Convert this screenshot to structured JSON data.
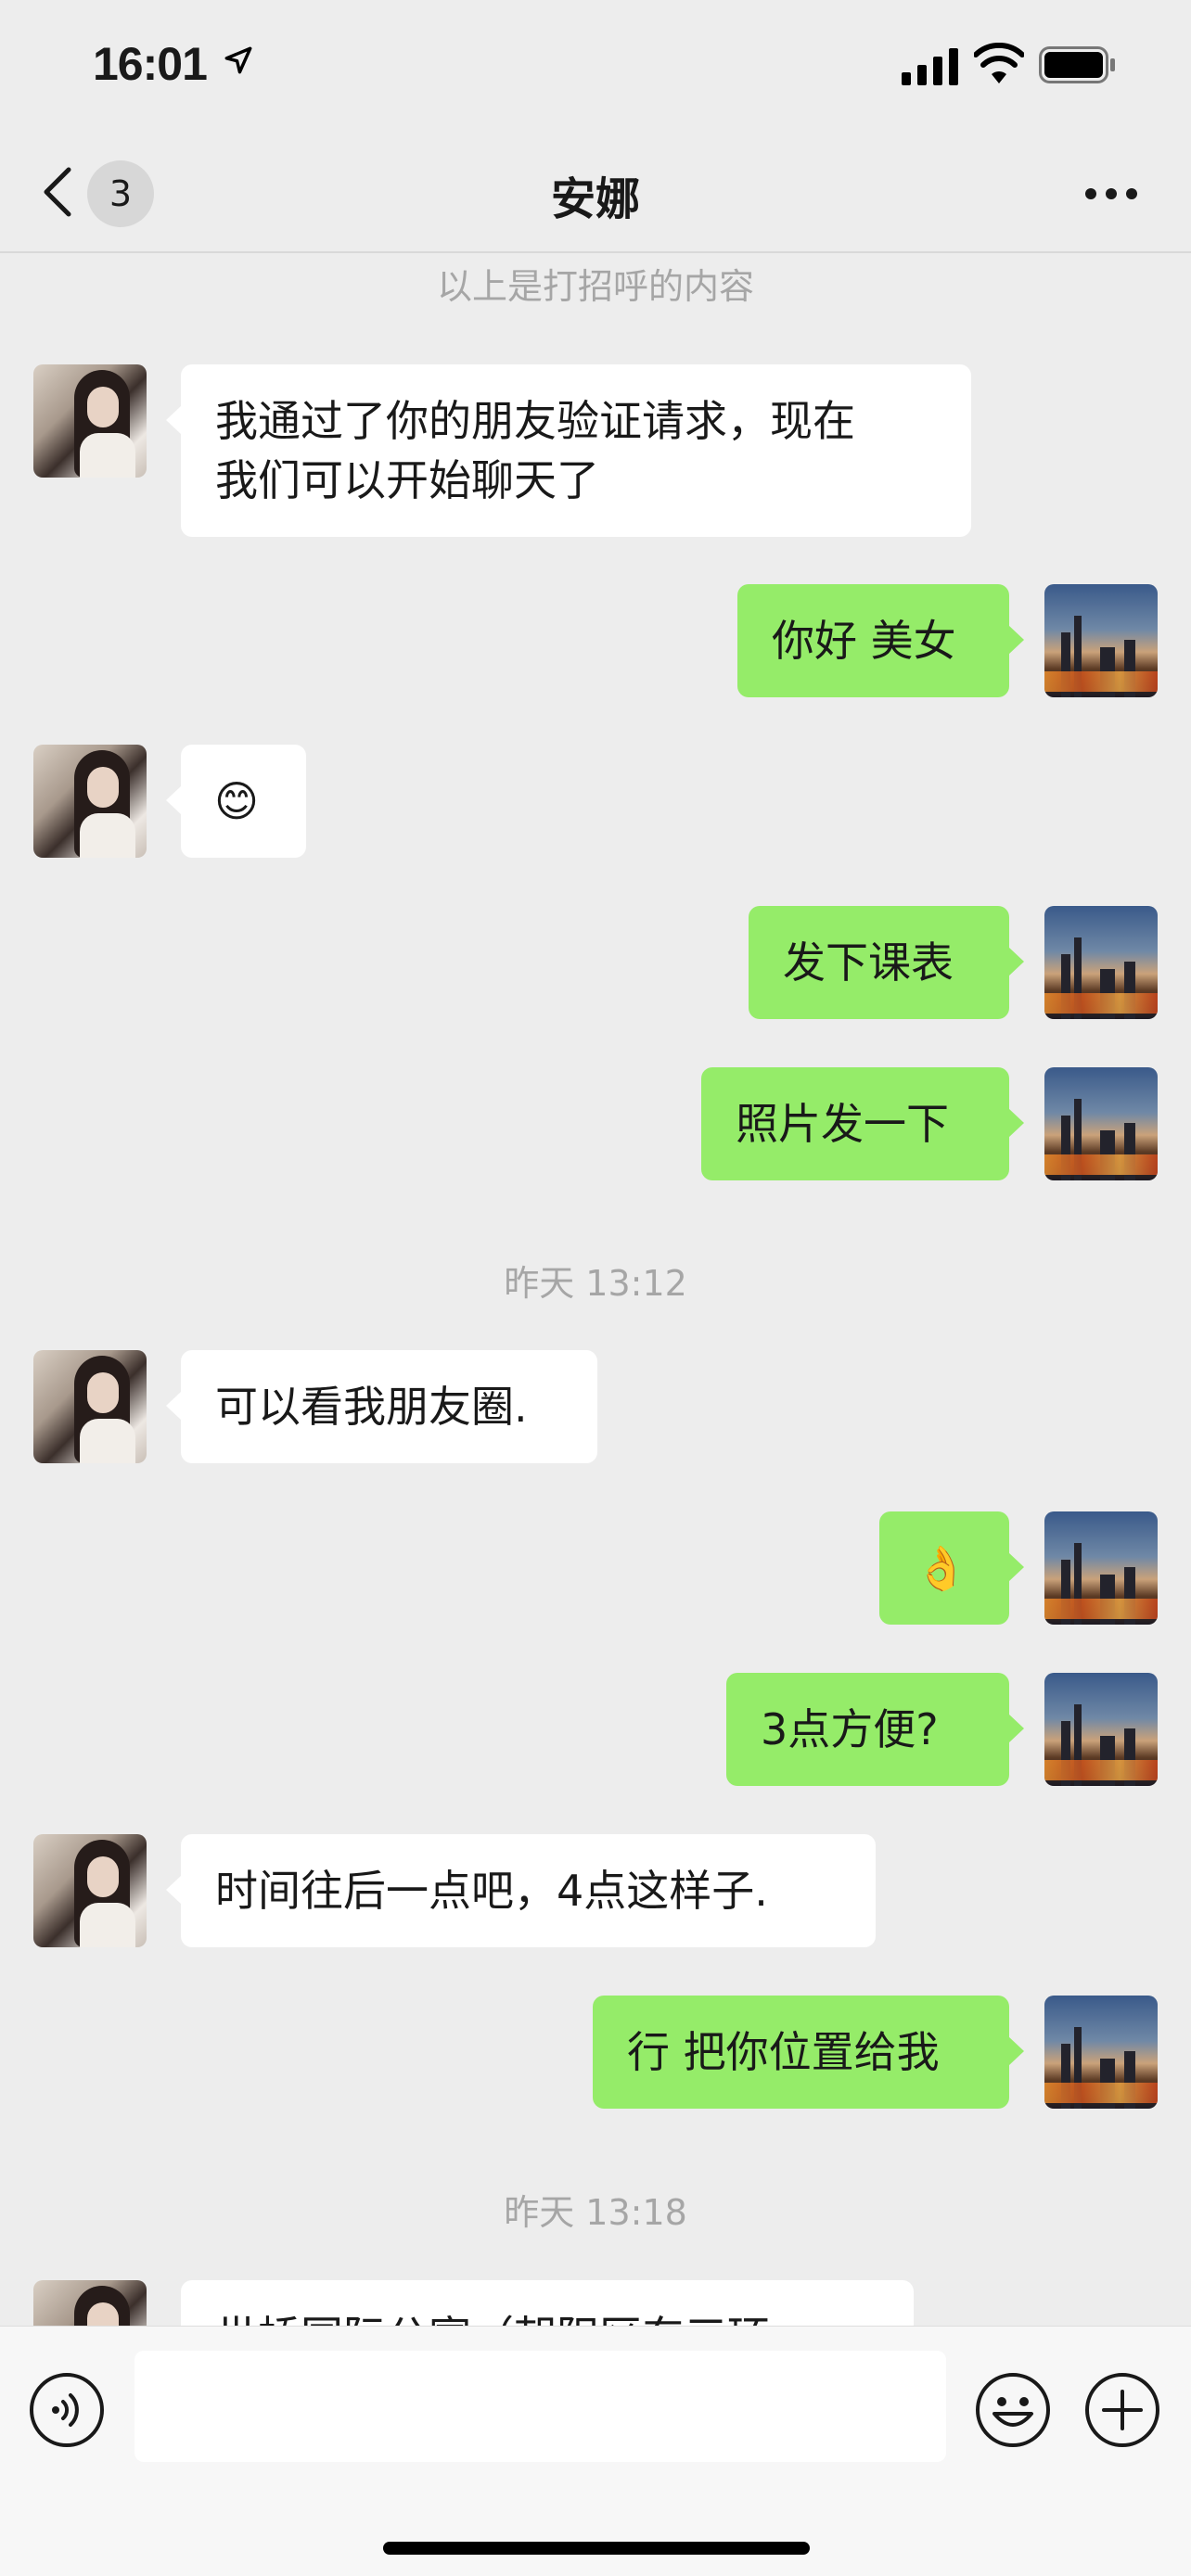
{
  "status_bar": {
    "time": "16:01"
  },
  "nav": {
    "back_count": "3",
    "title": "安娜"
  },
  "chat": {
    "greeting_note": "以上是打招呼的内容",
    "messages": [
      {
        "side": "left",
        "text": "我通过了你的朋友验证请求，现在\n我们可以开始聊天了"
      },
      {
        "side": "right",
        "text": "你好 美女"
      },
      {
        "side": "left",
        "text": "😊"
      },
      {
        "side": "right",
        "text": "发下课表"
      },
      {
        "side": "right",
        "text": "照片发一下"
      },
      {
        "side": "left",
        "text": "可以看我朋友圈."
      },
      {
        "side": "right",
        "text": "👌"
      },
      {
        "side": "right",
        "text": "3点方便?"
      },
      {
        "side": "left",
        "text": "时间往后一点吧，4点这样子."
      },
      {
        "side": "right",
        "text": "行 把你位置给我"
      },
      {
        "side": "left",
        "text": "世桥国际公寓（朝阳区东三环..."
      }
    ],
    "timestamps": [
      "昨天 13:12",
      "昨天 13:18"
    ]
  },
  "icons": {
    "location": "location-arrow-icon",
    "signal": "cellular-signal-icon",
    "wifi": "wifi-icon",
    "battery": "battery-icon",
    "back": "chevron-left-icon",
    "more": "more-dots-icon",
    "voice": "voice-icon",
    "emoji": "emoji-icon",
    "plus": "plus-icon"
  },
  "colors": {
    "background": "#ededed",
    "sent_bubble": "#95ec69",
    "received_bubble": "#ffffff"
  }
}
